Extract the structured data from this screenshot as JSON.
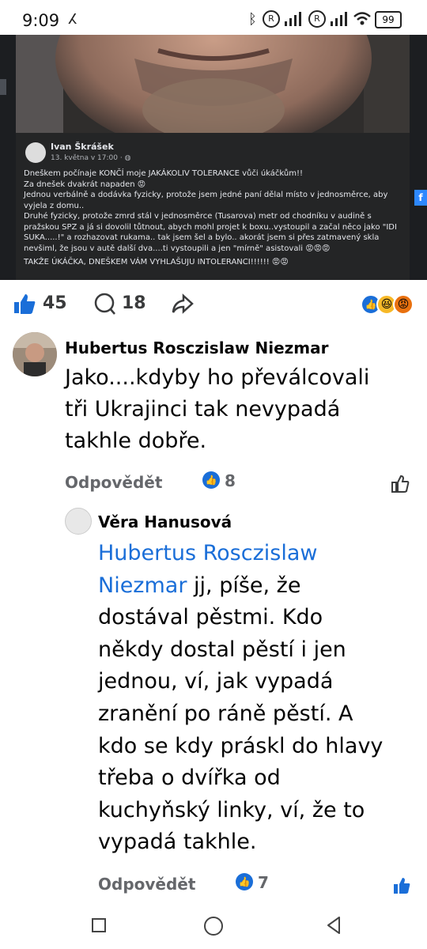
{
  "status_bar": {
    "time": "9:09",
    "battery": "99"
  },
  "post": {
    "author": "Ivan Škrášek",
    "date": "13. května v 17:00 · ",
    "paragraphs": [
      "Dneškem počínaje KONČÍ moje JAKÁKOLIV TOLERANCE vůči úkáčkům!!\nZa dnešek dvakrát napaden 😡",
      "Jednou verbálně a dodávka fyzicky, protože jsem jedné paní dělal místo v jednosměrce, aby vyjela z domu..",
      "Druhé fyzicky, protože zmrd stál v jednosměrce (Tusarova) metr od chodníku v audině s pražskou SPZ a já si dovolil tůtnout, abych mohl projet k boxu..vystoupil a začal něco jako \"IDI SUKA.....!\" a rozhazovat rukama.. tak jsem šel a bylo.. akorát jsem si přes zatmavený skla nevšiml, že jsou v autě další dva....ti vystoupili a jen \"mírně\" asistovali 😡😡😡",
      "TAKŽE ÚKÁČKA, DNEŠKEM VÁM VYHLAŠUJU INTOLERANCI!!!!!! 😡😡"
    ]
  },
  "reactions": {
    "likes": "45",
    "comments": "18"
  },
  "comment1": {
    "author": "Hubertus Rosczislaw Niezmar",
    "text": "Jako....kdyby ho převálcovali tři Ukrajinci tak nevypadá takhle dobře.",
    "reply_label": "Odpovědět",
    "like_count": "8"
  },
  "comment2": {
    "author": "Věra Hanusová",
    "mention": "Hubertus Rosczislaw Niezmar",
    "text": " jj, píše, že dostával pěstmi. Kdo někdy dostal pěstí i jen jednou, ví, jak vypadá zranění po ráně pěstí. A kdo se kdy práskl do hlavy třeba o dvířka od kuchyňský linky, ví, že to vypadá takhle.",
    "reply_label": "Odpovědět",
    "like_count": "7"
  },
  "colors": {
    "facebook_blue": "#1a6ed8",
    "meta_gray": "#65676b",
    "dark_card": "#242526"
  }
}
